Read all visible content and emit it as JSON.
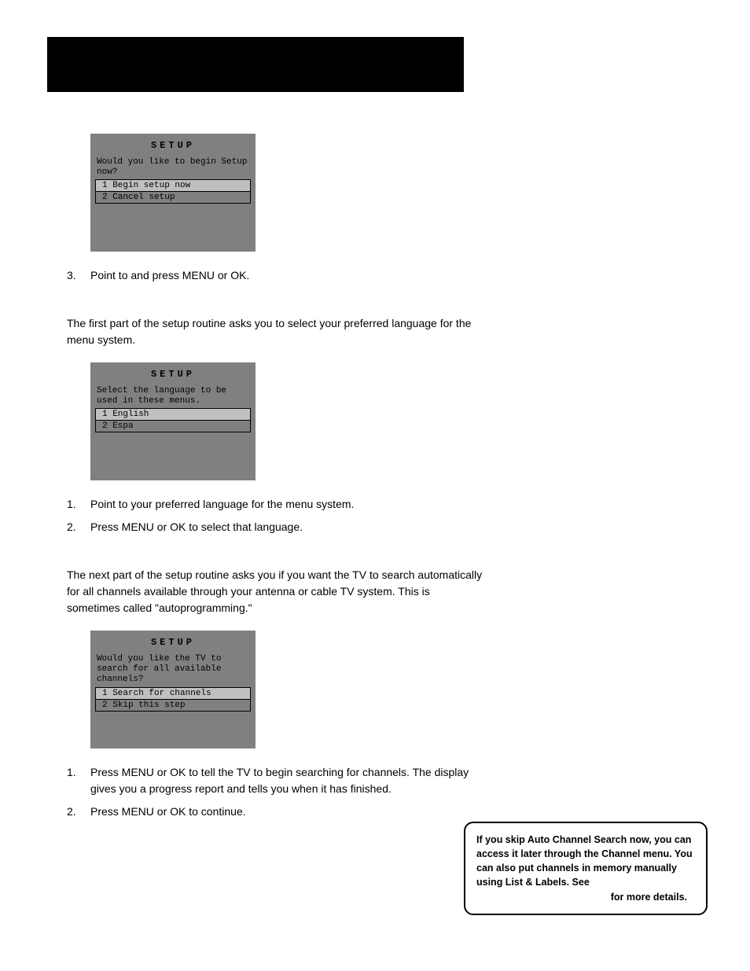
{
  "menu1": {
    "title": "SETUP",
    "prompt": "Would you like to begin Setup now?",
    "opt1": "1 Begin setup now",
    "opt2": "2 Cancel setup"
  },
  "step3": {
    "num": "3.",
    "a": "Point to ",
    "b": " and press MENU or OK."
  },
  "para1": "The first part of the setup routine asks you to select your preferred language for the menu system.",
  "menu2": {
    "title": "SETUP",
    "prompt": "Select the language to be used in these menus.",
    "opt1": "1 English",
    "opt2": "2 Espa"
  },
  "lang_step1": {
    "num": "1.",
    "text": "Point to your preferred language for the menu system."
  },
  "lang_step2": {
    "num": "2.",
    "text": "Press MENU or OK to select that language."
  },
  "para2": "The next part of the setup routine asks you if you want the TV to search automatically for all channels available through your antenna or cable TV system. This is sometimes called \"autoprogramming.\"",
  "menu3": {
    "title": "SETUP",
    "prompt": "Would you like the TV to search for all available channels?",
    "opt1": "1 Search for channels",
    "opt2": "2 Skip this step"
  },
  "search_step1": {
    "num": "1.",
    "text": "Press MENU or OK to tell the TV to begin searching for channels. The display gives you a progress report and tells you when it has finished."
  },
  "search_step2": {
    "num": "2.",
    "text": "Press MENU or OK to continue."
  },
  "callout": {
    "main": "If you skip Auto Channel Search now, you can access it later through the Channel menu. You can also put channels in memory manually using List & Labels. See",
    "tail": "for more details."
  }
}
